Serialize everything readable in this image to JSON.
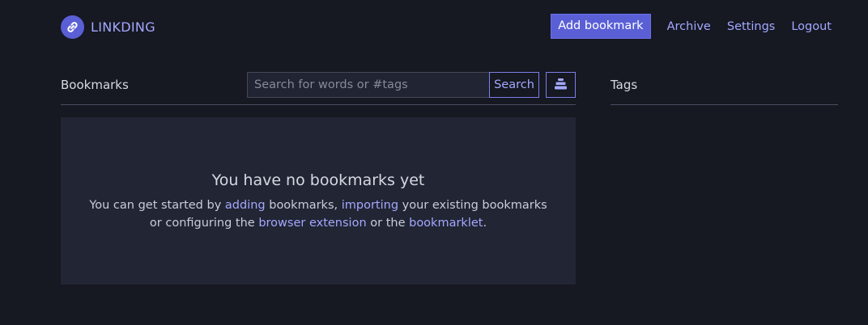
{
  "brand": {
    "name": "LINKDING",
    "logo_icon": "link-icon"
  },
  "nav": {
    "add_bookmark": "Add bookmark",
    "archive": "Archive",
    "settings": "Settings",
    "logout": "Logout"
  },
  "bookmarks": {
    "title": "Bookmarks",
    "search_placeholder": "Search for words or #tags",
    "search_value": "",
    "search_button": "Search",
    "bulk_edit_icon": "bulk-edit-icon",
    "empty": {
      "title": "You have no bookmarks yet",
      "t1": "You can get started by ",
      "link_adding": "adding",
      "t2": " bookmarks, ",
      "link_importing": "importing",
      "t3": " your existing bookmarks or configuring the ",
      "link_extension": "browser extension",
      "t4": " or the ",
      "link_bookmarklet": "bookmarklet",
      "t5": "."
    }
  },
  "tags": {
    "title": "Tags"
  },
  "colors": {
    "background": "#161822",
    "panel": "#222533",
    "accent": "#5a5fd6",
    "link": "#a3a8ff"
  }
}
